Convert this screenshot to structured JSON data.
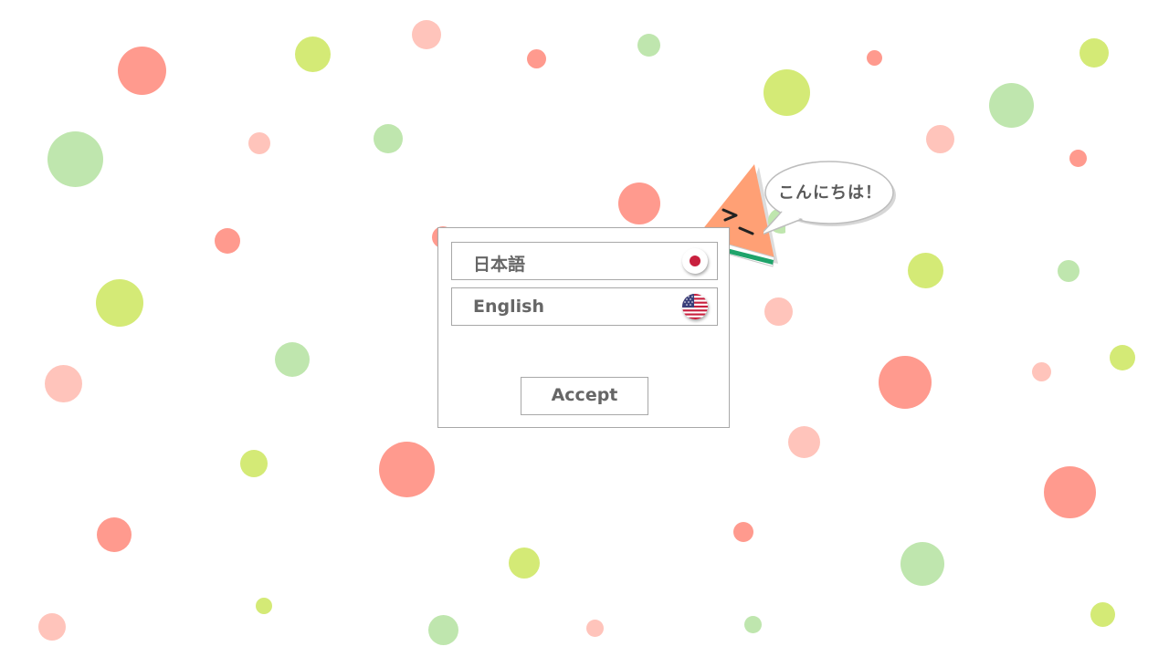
{
  "speech_bubble": {
    "text": "こんにちは！"
  },
  "language_dialog": {
    "options": [
      {
        "label": "日本語",
        "flag": "japan-flag-icon"
      },
      {
        "label": "English",
        "flag": "us-flag-icon"
      }
    ],
    "accept_label": "Accept"
  },
  "colors": {
    "dot_red": "#ff9a8e",
    "dot_pink": "#ffc4bb",
    "dot_lime": "#d4ea76",
    "dot_green": "#bfe6ae",
    "mascot_flesh": "#ffa075",
    "mascot_rind": "#1fa36a",
    "border": "#a8a8a8",
    "text": "#666666"
  }
}
